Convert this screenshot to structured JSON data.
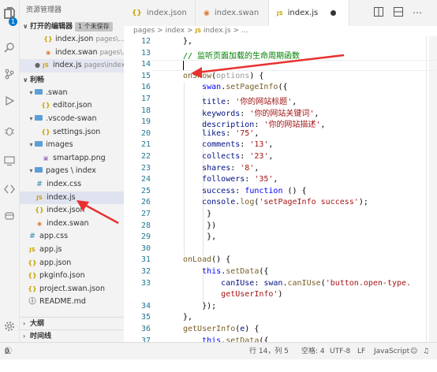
{
  "activity": {
    "badge_count": "1"
  },
  "sidebar": {
    "title": "资源管理器",
    "open_editors": {
      "title": "打开的编辑器",
      "unsaved_badge": "1 个未保存",
      "items": [
        {
          "icon": "{}",
          "name": "index.json",
          "path": "pages\\..."
        },
        {
          "icon": "rss",
          "name": "index.swan",
          "path": "pages\\..."
        },
        {
          "icon": "JS",
          "name": "index.js",
          "path": "pages\\index"
        }
      ]
    },
    "project": {
      "title": "利畅",
      "tree": [
        {
          "type": "folder",
          "name": ".swan"
        },
        {
          "type": "file",
          "icon": "{}",
          "name": "editor.json"
        },
        {
          "type": "folder",
          "name": ".vscode-swan"
        },
        {
          "type": "file",
          "icon": "{}",
          "name": "settings.json"
        },
        {
          "type": "folder",
          "name": "images"
        },
        {
          "type": "file",
          "icon": "img",
          "name": "smartapp.png"
        },
        {
          "type": "folder",
          "name": "pages \\ index"
        },
        {
          "type": "file",
          "icon": "#",
          "name": "index.css"
        },
        {
          "type": "file",
          "icon": "JS",
          "name": "index.js"
        },
        {
          "type": "file",
          "icon": "{}",
          "name": "index.json"
        },
        {
          "type": "file",
          "icon": "rss",
          "name": "index.swan"
        },
        {
          "type": "file",
          "icon": "#",
          "name": "app.css"
        },
        {
          "type": "file",
          "icon": "JS",
          "name": "app.js"
        },
        {
          "type": "file",
          "icon": "{}",
          "name": "app.json"
        },
        {
          "type": "file",
          "icon": "{}",
          "name": "pkginfo.json"
        },
        {
          "type": "file",
          "icon": "{}",
          "name": "project.swan.json"
        },
        {
          "type": "file",
          "icon": "i",
          "name": "README.md"
        }
      ]
    },
    "outline": "大纲",
    "timeline": "时间线"
  },
  "tabs": [
    {
      "icon": "{}",
      "label": "index.json"
    },
    {
      "icon": "rss",
      "label": "index.swan"
    },
    {
      "icon": "JS",
      "label": "index.js",
      "dirty": true
    }
  ],
  "breadcrumbs": {
    "part1": "pages",
    "sep": ">",
    "part2": "index",
    "part3_icon": "JS",
    "part3": "index.js",
    "part4": "..."
  },
  "code": {
    "lines": [
      {
        "n": "12",
        "html": "<span style=\"color:#000\">},</span>"
      },
      {
        "n": "13",
        "html": "<span style=\"color:#008000\">// 监听页面加载的生命周期函数</span>"
      },
      {
        "n": "14",
        "html": ""
      },
      {
        "n": "15",
        "html": "<span style=\"color:#795e26\">onShow</span>(<span style=\"color:#999\">options</span>) {"
      },
      {
        "n": "16",
        "html": "    <span style=\"color:#0000ff\">swan</span>.<span style=\"color:#795e26\">setPageInfo</span>({"
      },
      {
        "n": "17",
        "html": "    <span style=\"color:#001080\">title</span>: <span style=\"color:#a31515\">'你的网站标题'</span>,"
      },
      {
        "n": "18",
        "html": "    <span style=\"color:#001080\">keywords</span>: <span style=\"color:#a31515\">'你的网站关键词'</span>,"
      },
      {
        "n": "19",
        "html": "    <span style=\"color:#001080\">description</span>: <span style=\"color:#a31515\">'你的网站描述'</span>,"
      },
      {
        "n": "20",
        "html": "    <span style=\"color:#001080\">likes</span>: <span style=\"color:#a31515\">'75'</span>,"
      },
      {
        "n": "21",
        "html": "    <span style=\"color:#001080\">comments</span>: <span style=\"color:#a31515\">'13'</span>,"
      },
      {
        "n": "22",
        "html": "    <span style=\"color:#001080\">collects</span>: <span style=\"color:#a31515\">'23'</span>,"
      },
      {
        "n": "23",
        "html": "    <span style=\"color:#001080\">shares</span>: <span style=\"color:#a31515\">'8'</span>,"
      },
      {
        "n": "24",
        "html": "    <span style=\"color:#001080\">followers</span>: <span style=\"color:#a31515\">'35'</span>,"
      },
      {
        "n": "25",
        "html": "    <span style=\"color:#001080\">success</span>: <span style=\"color:#0000ff\">function</span> () {"
      },
      {
        "n": "26",
        "html": "    <span style=\"color:#001080\">console</span>.<span style=\"color:#795e26\">log</span>(<span style=\"color:#a31515\">'setPageInfo success'</span>);"
      },
      {
        "n": "27",
        "html": "     }"
      },
      {
        "n": "28",
        "html": "     })"
      },
      {
        "n": "29",
        "html": "     },"
      },
      {
        "n": "30",
        "html": ""
      },
      {
        "n": "31",
        "html": "<span style=\"color:#795e26\">onLoad</span>() {"
      },
      {
        "n": "32",
        "html": "    <span style=\"color:#0000ff\">this</span>.<span style=\"color:#795e26\">setData</span>({"
      },
      {
        "n": "33",
        "html": "        <span style=\"color:#001080\">canIUse</span>: <span style=\"color:#001080\">swan</span>.<span style=\"color:#795e26\">canIUse</span>(<span style=\"color:#a31515\">'button.open-type.</span>"
      },
      {
        "n": "",
        "html": "        <span style=\"color:#a31515\">getUserInfo'</span>)"
      },
      {
        "n": "34",
        "html": "    });"
      },
      {
        "n": "35",
        "html": "},"
      },
      {
        "n": "36",
        "html": "<span style=\"color:#795e26\">getUserInfo</span>(<span style=\"color:#001080\">e</span>) {"
      },
      {
        "n": "37",
        "html": "    <span style=\"color:#0000ff\">this</span>.<span style=\"color:#795e26\">setData</span>({"
      }
    ]
  },
  "status": {
    "errors": "0",
    "warnings": "0",
    "position": "行 14，列 5",
    "spaces": "空格: 4",
    "encoding": "UTF-8",
    "eol": "LF",
    "language": "JavaScript"
  },
  "colors": {
    "accent": "#007acc",
    "annotation_arrow": "#e8312f"
  }
}
